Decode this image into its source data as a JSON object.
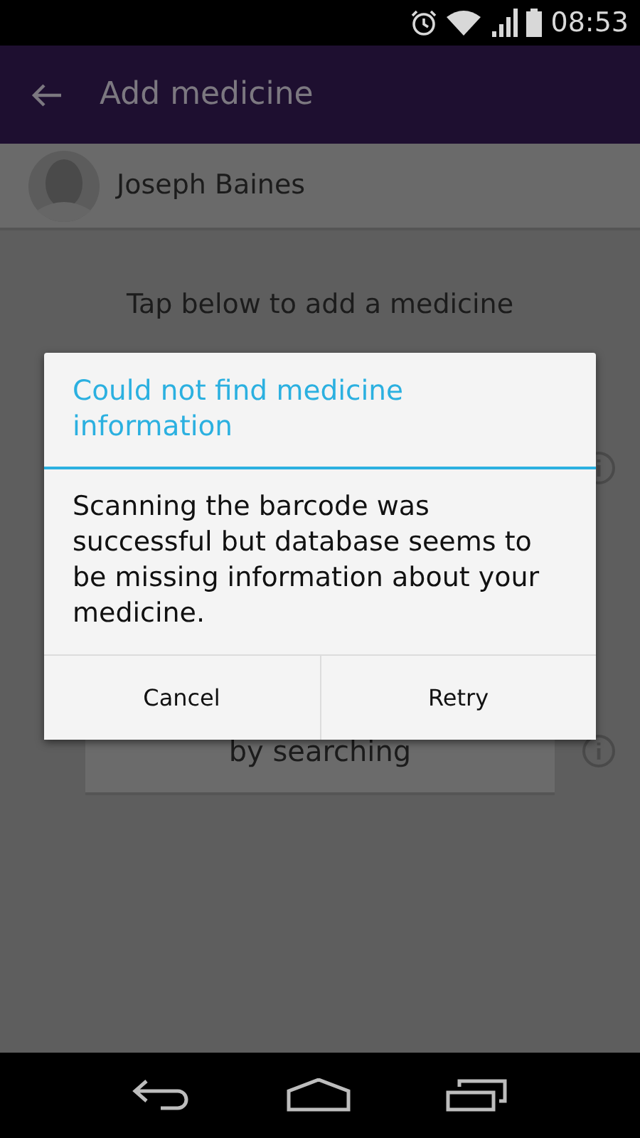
{
  "status_bar": {
    "time": "08:53"
  },
  "app_bar": {
    "title": "Add medicine"
  },
  "user": {
    "name": "Joseph Baines"
  },
  "prompt": "Tap below to add a medicine",
  "search_option": {
    "label": "by searching"
  },
  "dialog": {
    "title": "Could not find medicine information",
    "message": "Scanning the barcode was successful but database seems to be missing information about your medicine.",
    "buttons": [
      "Cancel",
      "Retry"
    ]
  }
}
